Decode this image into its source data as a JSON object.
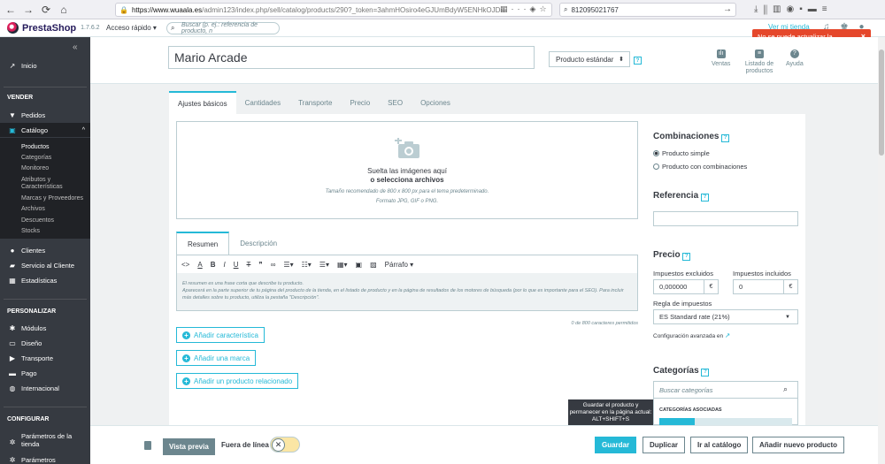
{
  "browser": {
    "url_domain": "https://www.wuaala.es",
    "url_rest": "/admin123/index.php/sell/catalog/products/290?_token=3ahmHOsiro4eGJUmBdyW5ENHkOJDrt",
    "search_value": "812095021767"
  },
  "header": {
    "logo_text": "PrestaShop",
    "version": "1.7.6.2",
    "quick_access": "Acceso rápido ▾",
    "search_placeholder": "Buscar (p. ej.: referencia de producto, n",
    "view_store": "Ver mi tienda"
  },
  "toast": {
    "message": "No se puede actualizar la configuración.",
    "close": "×"
  },
  "sidebar": {
    "inicio": "Inicio",
    "section_vender": "VENDER",
    "pedidos": "Pedidos",
    "catalogo": "Catálogo",
    "sub_items": [
      "Productos",
      "Categorías",
      "Monitoreo",
      "Atributos y Características",
      "Marcas y Proveedores",
      "Archivos",
      "Descuentos",
      "Stocks"
    ],
    "clientes": "Clientes",
    "servicio": "Servicio al Cliente",
    "estadisticas": "Estadísticas",
    "section_personalizar": "PERSONALIZAR",
    "modulos": "Módulos",
    "diseno": "Diseño",
    "transporte": "Transporte",
    "pago": "Pago",
    "internacional": "Internacional",
    "section_configurar": "CONFIGURAR",
    "parametros_tienda": "Parámetros de la tienda",
    "parametros": "Parámetros"
  },
  "product": {
    "name": "Mario Arcade",
    "type": "Producto estándar",
    "toolbar": {
      "ventas": "Ventas",
      "listado": "Listado de productos",
      "ayuda": "Ayuda"
    }
  },
  "tabs": [
    "Ajustes básicos",
    "Cantidades",
    "Transporte",
    "Precio",
    "SEO",
    "Opciones"
  ],
  "dropzone": {
    "line1": "Suelta las imágenes aquí",
    "line2": "o selecciona archivos",
    "line3": "Tamaño recomendado de 800 x 800 px para el tema predeterminado.",
    "line4": "Formato JPG, GIF o PNG."
  },
  "description": {
    "tab_resumen": "Resumen",
    "tab_descripcion": "Descripción",
    "paragraph": "Párrafo",
    "placeholder_1": "El resumen es una frase corta que describe tu producto.",
    "placeholder_2": "Aparecerá en la parte superior de tu página del producto de la tienda, en el listado de producto y en la página de resultados de los motores de búsqueda (por lo que es importante para el SEO). Para incluir más detalles sobre tu producto, utiliza la pestaña \"Descripción\".",
    "char_count": "0 de 800 caracteres permitidos"
  },
  "buttons": {
    "add_feature": "Añadir característica",
    "add_brand": "Añadir una marca",
    "add_related": "Añadir un producto relacionado"
  },
  "right": {
    "combinaciones": "Combinaciones",
    "producto_simple": "Producto simple",
    "producto_comb": "Producto con combinaciones",
    "referencia": "Referencia",
    "precio": "Precio",
    "imp_excluidos": "Impuestos excluidos",
    "imp_incluidos": "Impuestos incluidos",
    "price_excl": "0,000000",
    "price_incl": "0",
    "currency": "€",
    "regla": "Regla de impuestos",
    "tax_rule": "ES Standard rate (21%)",
    "config_avanzada": "Configuración avanzada en",
    "precios_link": "Precios",
    "categorias": "Categorías",
    "buscar_cat": "Buscar categorías",
    "cat_asociadas": "CATEGORÍAS ASOCIADAS"
  },
  "tooltip": "Guardar el producto y permanecer en la página actual: ALT+SHIFT+S",
  "footer": {
    "preview": "Vista previa",
    "offline": "Fuera de línea",
    "save": "Guardar",
    "duplicate": "Duplicar",
    "catalog": "Ir al catálogo",
    "new_product": "Añadir nuevo producto"
  },
  "colors": {
    "accent": "#25b9d7",
    "error": "#e5472b",
    "sidebar": "#363a41"
  }
}
